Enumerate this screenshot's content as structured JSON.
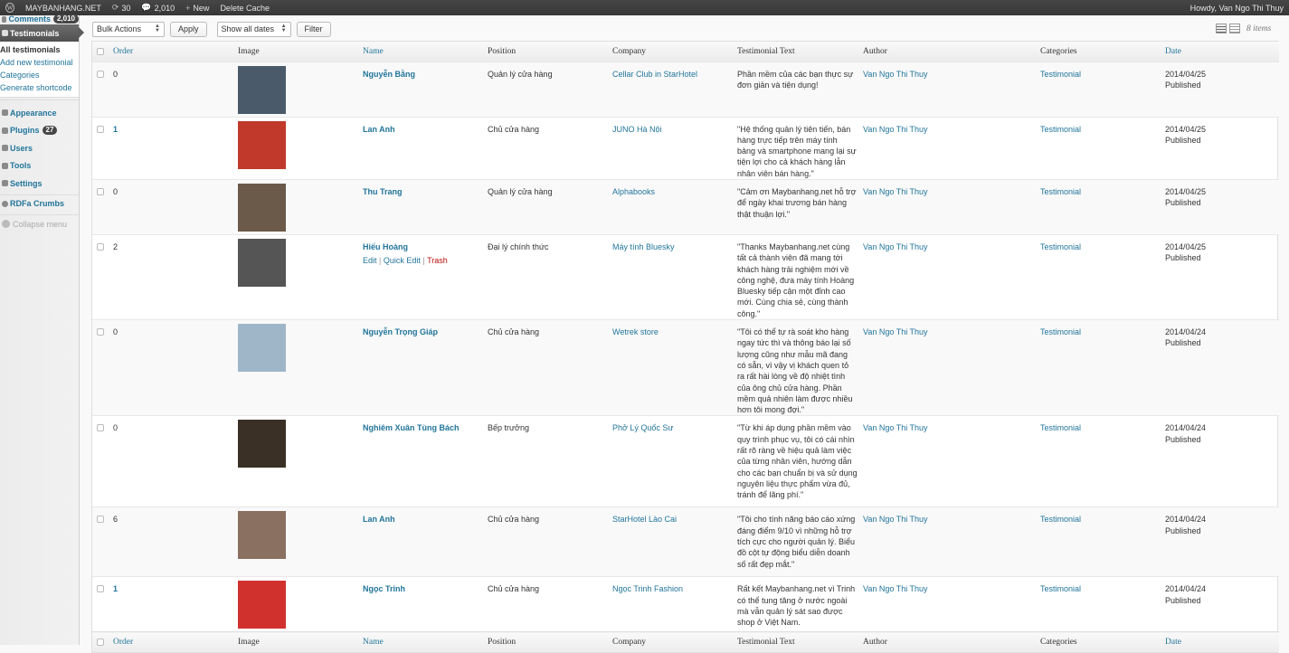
{
  "adminbar": {
    "site": "MAYBANHANG.NET",
    "updates": "30",
    "comments": "2,010",
    "new": "New",
    "cache": "Delete Cache",
    "howdy": "Howdy, Van Ngo Thi Thuy"
  },
  "sidebar": {
    "comments": "Comments",
    "comments_count": "2,010",
    "current": "Testimonials",
    "submenu": [
      "All testimonials",
      "Add new testimonial",
      "Categories",
      "Generate shortcode"
    ],
    "appearance": "Appearance",
    "plugins": "Plugins",
    "plugins_count": "27",
    "users": "Users",
    "tools": "Tools",
    "settings": "Settings",
    "rdfa": "RDFa Crumbs",
    "collapse": "Collapse menu"
  },
  "toolbar": {
    "bulk": "Bulk Actions",
    "apply": "Apply",
    "dates": "Show all dates",
    "filter": "Filter",
    "items": "8 items"
  },
  "columns": {
    "order": "Order",
    "image": "Image",
    "name": "Name",
    "position": "Position",
    "company": "Company",
    "text": "Testimonial Text",
    "author": "Author",
    "categories": "Categories",
    "date": "Date"
  },
  "rows": [
    {
      "order": "0",
      "name": "Nguyễn Bằng",
      "position": "Quản lý cửa hàng",
      "company": "Cellar Club in StarHotel",
      "text": "Phần mềm của các bạn thực sự đơn giản và tiện dụng!",
      "author": "Van Ngo Thi Thuy",
      "category": "Testimonial",
      "date": "2014/04/25",
      "status": "Published",
      "img": "#4a5a6a"
    },
    {
      "order": "1",
      "name": "Lan Anh",
      "position": "Chủ cửa hàng",
      "company": "JUNO Hà Nội",
      "text": "\"Hệ thống quản lý tiên tiến, bán hàng trực tiếp trên máy tính bảng và smartphone mang lại sự tiện lợi cho cả khách hàng lẫn nhân viên bán hàng.\"",
      "author": "Van Ngo Thi Thuy",
      "category": "Testimonial",
      "date": "2014/04/25",
      "status": "Published",
      "img": "#c0392b"
    },
    {
      "order": "0",
      "name": "Thu Trang",
      "position": "Quản lý cửa hàng",
      "company": "Alphabooks",
      "text": "\"Cảm ơn Maybanhang.net hỗ trợ để ngày khai trương bán hàng thật thuận lợi.\"",
      "author": "Van Ngo Thi Thuy",
      "category": "Testimonial",
      "date": "2014/04/25",
      "status": "Published",
      "img": "#6b5a4a"
    },
    {
      "order": "2",
      "name": "Hiếu Hoàng",
      "position": "Đại lý chính thức",
      "company": "Máy tính Bluesky",
      "text": "\"Thanks Maybanhang.net cùng tất cả thành viên đã mang tới khách hàng trải nghiệm mới về công nghệ, đưa máy tính Hoàng Bluesky tiếp cận một đỉnh cao mới. Cùng chia sẻ, cùng thành công.\"",
      "author": "Van Ngo Thi Thuy",
      "category": "Testimonial",
      "date": "2014/04/25",
      "status": "Published",
      "img": "#555555",
      "actions": {
        "edit": "Edit",
        "quick": "Quick Edit",
        "trash": "Trash"
      }
    },
    {
      "order": "0",
      "name": "Nguyễn Trọng Giáp",
      "position": "Chủ cửa hàng",
      "company": "Wetrek store",
      "text": "\"Tôi có thể tự rà soát kho hàng ngay tức thì và thông báo lại số lượng cũng như mẫu mã đang có sẵn, vì vậy vị khách quen tỏ ra rất hài lòng về độ nhiệt tình của ông chủ cửa hàng. Phần mềm quả nhiên làm được nhiều hơn tôi mong đợi.\"",
      "author": "Van Ngo Thi Thuy",
      "category": "Testimonial",
      "date": "2014/04/24",
      "status": "Published",
      "img": "#9fb6c8"
    },
    {
      "order": "0",
      "name": "Nghiêm Xuân Tùng Bách",
      "position": "Bếp trưởng",
      "company": "Phở Lý Quốc Sư",
      "text": "\"Từ khi áp dụng phần mềm vào quy trình phục vụ, tôi có cái nhìn rất rõ ràng về hiệu quả làm việc của từng nhân viên, hướng dẫn cho các bạn chuẩn bị và sử dụng nguyên liệu thực phẩm vừa đủ, tránh để lãng phí.\"",
      "author": "Van Ngo Thi Thuy",
      "category": "Testimonial",
      "date": "2014/04/24",
      "status": "Published",
      "img": "#3a3026"
    },
    {
      "order": "6",
      "name": "Lan Anh",
      "position": "Chủ cửa hàng",
      "company": "StarHotel Lào Cai",
      "text": "\"Tôi cho tính năng báo cáo xứng đáng điểm 9/10 vì những hỗ trợ tích cực cho người quản lý. Biểu đồ cột tự động biểu diễn doanh số rất đẹp mắt.\"",
      "author": "Van Ngo Thi Thuy",
      "category": "Testimonial",
      "date": "2014/04/24",
      "status": "Published",
      "img": "#8a7060"
    },
    {
      "order": "1",
      "name": "Ngọc Trinh",
      "position": "Chủ cửa hàng",
      "company": "Ngọc Trinh Fashion",
      "text": "Rất kết Maybanhang.net vì Trinh có thể tung tăng ở nước ngoài mà vẫn quản lý sát sao được shop ở Việt Nam.",
      "author": "Van Ngo Thi Thuy",
      "category": "Testimonial",
      "date": "2014/04/24",
      "status": "Published",
      "img": "#d0312d"
    }
  ]
}
